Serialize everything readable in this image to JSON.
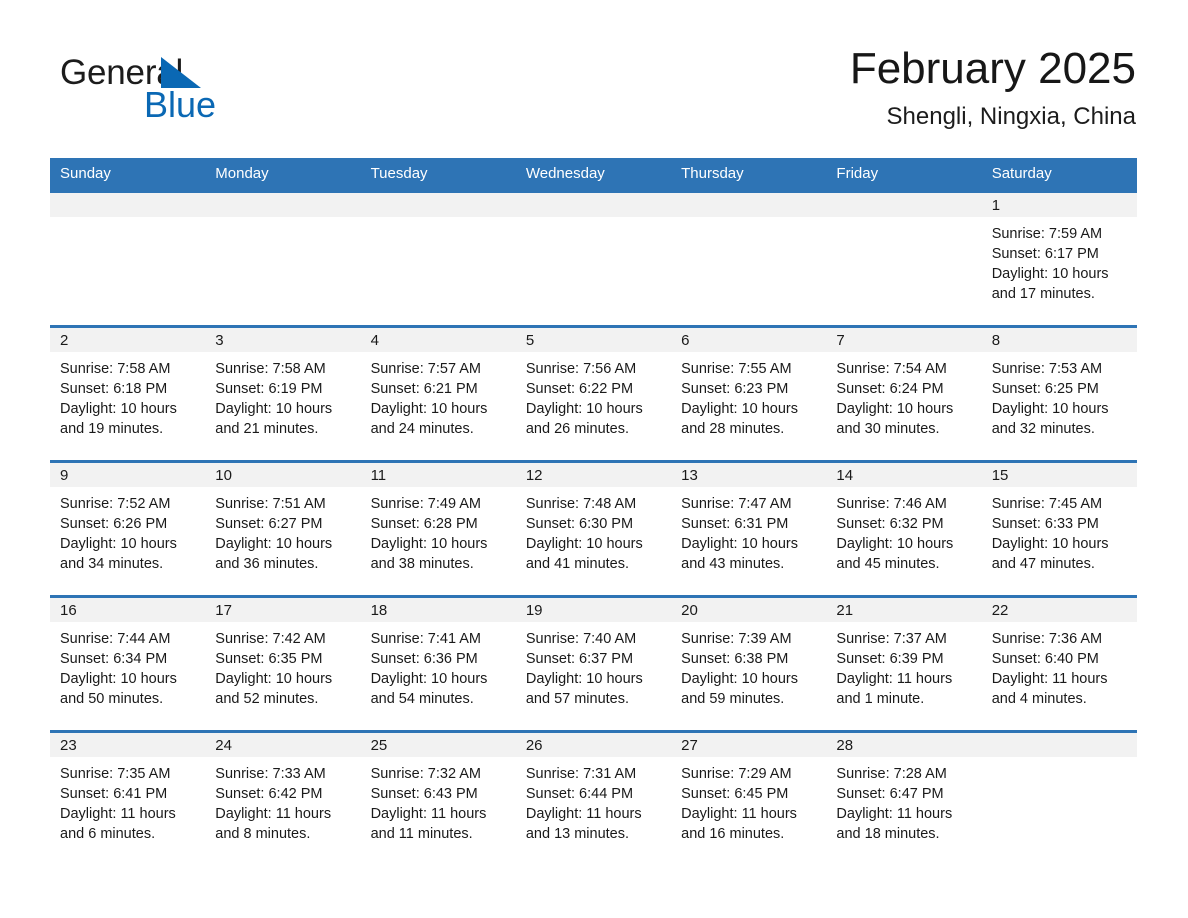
{
  "logo": {
    "word_one": "General",
    "word_two": "Blue",
    "triangle_color": "#0a68b4",
    "icon": "triangle-icon"
  },
  "header": {
    "title": "February 2025",
    "location": "Shengli, Ningxia, China"
  },
  "theme": {
    "header_blue": "#2e74b5",
    "row_divider_blue": "#2e74b5",
    "daynum_band": "#f2f2f2",
    "page_background": "#ffffff",
    "text": "#1a1a1a"
  },
  "calendar": {
    "weekday_headers": [
      "Sunday",
      "Monday",
      "Tuesday",
      "Wednesday",
      "Thursday",
      "Friday",
      "Saturday"
    ],
    "weeks": [
      {
        "cells": [
          {
            "day": "",
            "empty": true
          },
          {
            "day": "",
            "empty": true
          },
          {
            "day": "",
            "empty": true
          },
          {
            "day": "",
            "empty": true
          },
          {
            "day": "",
            "empty": true
          },
          {
            "day": "",
            "empty": true
          },
          {
            "day": "1",
            "sunrise": "Sunrise: 7:59 AM",
            "sunset": "Sunset: 6:17 PM",
            "daylight": "Daylight: 10 hours and 17 minutes."
          }
        ]
      },
      {
        "cells": [
          {
            "day": "2",
            "sunrise": "Sunrise: 7:58 AM",
            "sunset": "Sunset: 6:18 PM",
            "daylight": "Daylight: 10 hours and 19 minutes."
          },
          {
            "day": "3",
            "sunrise": "Sunrise: 7:58 AM",
            "sunset": "Sunset: 6:19 PM",
            "daylight": "Daylight: 10 hours and 21 minutes."
          },
          {
            "day": "4",
            "sunrise": "Sunrise: 7:57 AM",
            "sunset": "Sunset: 6:21 PM",
            "daylight": "Daylight: 10 hours and 24 minutes."
          },
          {
            "day": "5",
            "sunrise": "Sunrise: 7:56 AM",
            "sunset": "Sunset: 6:22 PM",
            "daylight": "Daylight: 10 hours and 26 minutes."
          },
          {
            "day": "6",
            "sunrise": "Sunrise: 7:55 AM",
            "sunset": "Sunset: 6:23 PM",
            "daylight": "Daylight: 10 hours and 28 minutes."
          },
          {
            "day": "7",
            "sunrise": "Sunrise: 7:54 AM",
            "sunset": "Sunset: 6:24 PM",
            "daylight": "Daylight: 10 hours and 30 minutes."
          },
          {
            "day": "8",
            "sunrise": "Sunrise: 7:53 AM",
            "sunset": "Sunset: 6:25 PM",
            "daylight": "Daylight: 10 hours and 32 minutes."
          }
        ]
      },
      {
        "cells": [
          {
            "day": "9",
            "sunrise": "Sunrise: 7:52 AM",
            "sunset": "Sunset: 6:26 PM",
            "daylight": "Daylight: 10 hours and 34 minutes."
          },
          {
            "day": "10",
            "sunrise": "Sunrise: 7:51 AM",
            "sunset": "Sunset: 6:27 PM",
            "daylight": "Daylight: 10 hours and 36 minutes."
          },
          {
            "day": "11",
            "sunrise": "Sunrise: 7:49 AM",
            "sunset": "Sunset: 6:28 PM",
            "daylight": "Daylight: 10 hours and 38 minutes."
          },
          {
            "day": "12",
            "sunrise": "Sunrise: 7:48 AM",
            "sunset": "Sunset: 6:30 PM",
            "daylight": "Daylight: 10 hours and 41 minutes."
          },
          {
            "day": "13",
            "sunrise": "Sunrise: 7:47 AM",
            "sunset": "Sunset: 6:31 PM",
            "daylight": "Daylight: 10 hours and 43 minutes."
          },
          {
            "day": "14",
            "sunrise": "Sunrise: 7:46 AM",
            "sunset": "Sunset: 6:32 PM",
            "daylight": "Daylight: 10 hours and 45 minutes."
          },
          {
            "day": "15",
            "sunrise": "Sunrise: 7:45 AM",
            "sunset": "Sunset: 6:33 PM",
            "daylight": "Daylight: 10 hours and 47 minutes."
          }
        ]
      },
      {
        "cells": [
          {
            "day": "16",
            "sunrise": "Sunrise: 7:44 AM",
            "sunset": "Sunset: 6:34 PM",
            "daylight": "Daylight: 10 hours and 50 minutes."
          },
          {
            "day": "17",
            "sunrise": "Sunrise: 7:42 AM",
            "sunset": "Sunset: 6:35 PM",
            "daylight": "Daylight: 10 hours and 52 minutes."
          },
          {
            "day": "18",
            "sunrise": "Sunrise: 7:41 AM",
            "sunset": "Sunset: 6:36 PM",
            "daylight": "Daylight: 10 hours and 54 minutes."
          },
          {
            "day": "19",
            "sunrise": "Sunrise: 7:40 AM",
            "sunset": "Sunset: 6:37 PM",
            "daylight": "Daylight: 10 hours and 57 minutes."
          },
          {
            "day": "20",
            "sunrise": "Sunrise: 7:39 AM",
            "sunset": "Sunset: 6:38 PM",
            "daylight": "Daylight: 10 hours and 59 minutes."
          },
          {
            "day": "21",
            "sunrise": "Sunrise: 7:37 AM",
            "sunset": "Sunset: 6:39 PM",
            "daylight": "Daylight: 11 hours and 1 minute."
          },
          {
            "day": "22",
            "sunrise": "Sunrise: 7:36 AM",
            "sunset": "Sunset: 6:40 PM",
            "daylight": "Daylight: 11 hours and 4 minutes."
          }
        ]
      },
      {
        "cells": [
          {
            "day": "23",
            "sunrise": "Sunrise: 7:35 AM",
            "sunset": "Sunset: 6:41 PM",
            "daylight": "Daylight: 11 hours and 6 minutes."
          },
          {
            "day": "24",
            "sunrise": "Sunrise: 7:33 AM",
            "sunset": "Sunset: 6:42 PM",
            "daylight": "Daylight: 11 hours and 8 minutes."
          },
          {
            "day": "25",
            "sunrise": "Sunrise: 7:32 AM",
            "sunset": "Sunset: 6:43 PM",
            "daylight": "Daylight: 11 hours and 11 minutes."
          },
          {
            "day": "26",
            "sunrise": "Sunrise: 7:31 AM",
            "sunset": "Sunset: 6:44 PM",
            "daylight": "Daylight: 11 hours and 13 minutes."
          },
          {
            "day": "27",
            "sunrise": "Sunrise: 7:29 AM",
            "sunset": "Sunset: 6:45 PM",
            "daylight": "Daylight: 11 hours and 16 minutes."
          },
          {
            "day": "28",
            "sunrise": "Sunrise: 7:28 AM",
            "sunset": "Sunset: 6:47 PM",
            "daylight": "Daylight: 11 hours and 18 minutes."
          },
          {
            "day": "",
            "empty": true
          }
        ]
      }
    ]
  }
}
